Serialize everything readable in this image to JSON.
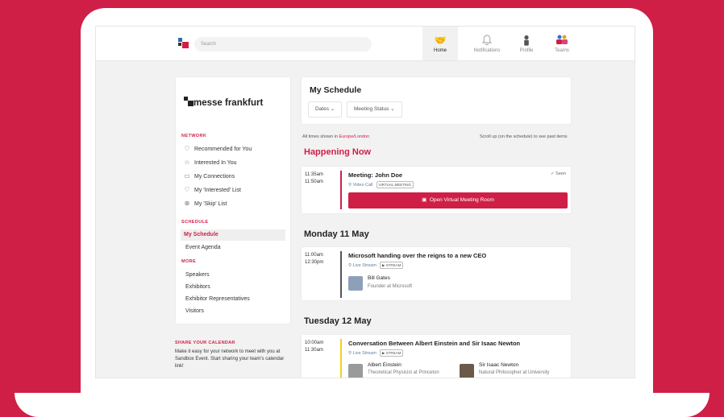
{
  "topbar": {
    "search_placeholder": "Search",
    "nav": [
      {
        "label": "Home",
        "icon": "handshake-icon"
      },
      {
        "label": "Notifications",
        "icon": "bell-icon"
      },
      {
        "label": "Profile",
        "icon": "person-icon"
      },
      {
        "label": "Teams",
        "icon": "team-icon"
      }
    ]
  },
  "sidebar": {
    "brand": "messe frankfurt",
    "network_title": "NETWORK",
    "network_items": [
      {
        "label": "Recommended for You",
        "icon": "hearts-icon"
      },
      {
        "label": "Interested In You",
        "icon": "star-icon"
      },
      {
        "label": "My Connections",
        "icon": "chat-icon"
      },
      {
        "label": "My 'Interested' List",
        "icon": "hearts-icon"
      },
      {
        "label": "My 'Skip' List",
        "icon": "cross-circle-icon"
      }
    ],
    "schedule_title": "SCHEDULE",
    "schedule_items": [
      "My Schedule",
      "Event Agenda"
    ],
    "more_title": "MORE",
    "more_items": [
      "Speakers",
      "Exhibitors",
      "Exhibitor Representatives",
      "Visitors"
    ],
    "share_title": "SHARE YOUR CALENDAR",
    "share_text": "Make it easy for your network to meet with you at Sandbox Event. Start sharing your team's calendar link!"
  },
  "schedule": {
    "title": "My Schedule",
    "filter_dates": "Dates",
    "filter_status": "Meeting Status",
    "tz_prefix": "All times shown in ",
    "tz_value": "Europe/London",
    "scroll_note": "Scroll up (on the schedule) to see past items",
    "happening_now": "Happening Now",
    "now_event": {
      "start": "11:35am",
      "end": "11:50am",
      "title": "Meeting: John Doe",
      "type": "Video Call",
      "tag": "VIRTUAL MEETING",
      "seen": "✓ Seen",
      "button": "Open Virtual Meeting Room"
    },
    "day1": "Monday 11 May",
    "event1": {
      "start": "11:00am",
      "end": "12:30pm",
      "title": "Microsoft handing over the reigns to a new CEO",
      "type": "Live Stream",
      "tag": "STREAM",
      "speaker_name": "Bill Gates",
      "speaker_role": "Founder at Microsoft"
    },
    "day2": "Tuesday 12 May",
    "event2": {
      "start": "10:00am",
      "end": "11:30am",
      "title": "Conversation Between Albert Einstein and Sir Isaac Newton",
      "type": "Live Stream",
      "tag": "STREAM",
      "speaker1_name": "Albert Einstein",
      "speaker1_role": "Theoretical Physicist at Princeton",
      "speaker2_name": "Sir Isaac Newton",
      "speaker2_role": "Natural Philosopher at University"
    }
  },
  "colors": {
    "accent": "#cf1f47",
    "bar_now": "#cf1f47",
    "bar_past": "#555555",
    "bar_upcoming": "#f2d21b"
  }
}
